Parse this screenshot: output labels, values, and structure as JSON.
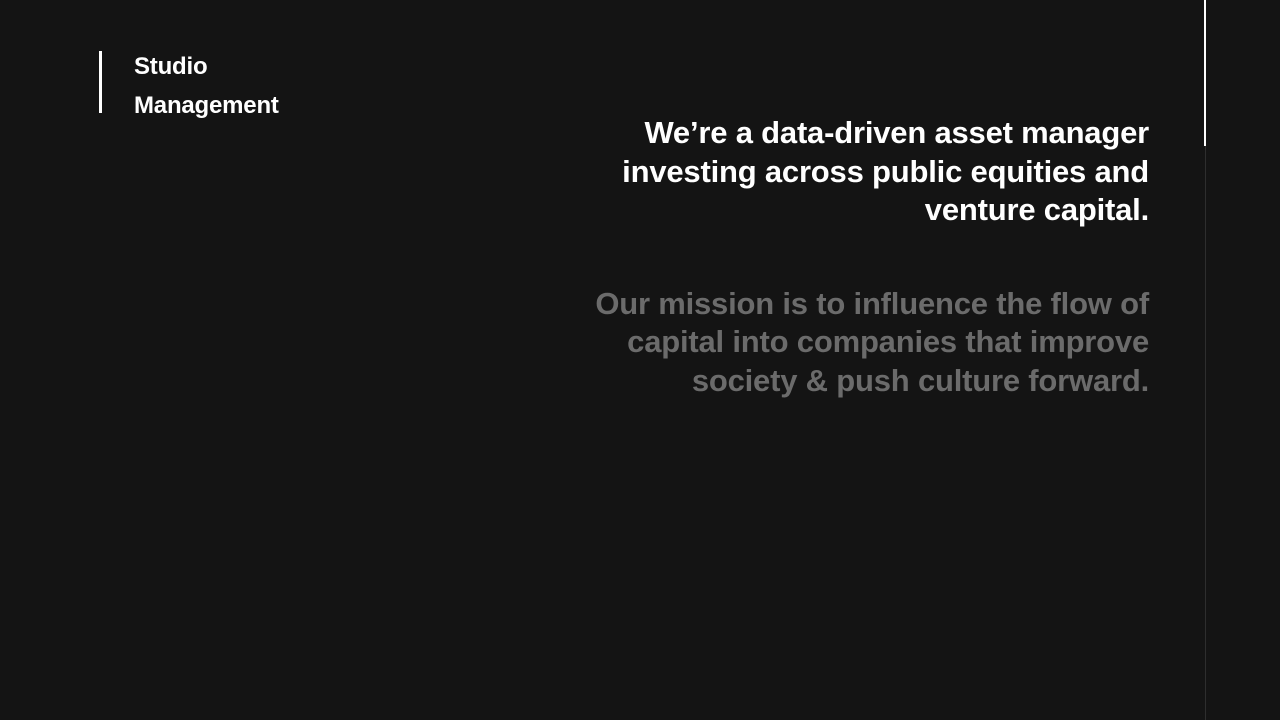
{
  "brand": {
    "line1": "Studio",
    "line2": "Management"
  },
  "headline": {
    "line1": "We’re a data-driven asset manager",
    "line2": "investing across public equities and",
    "line3": "venture capital."
  },
  "mission": {
    "line1": "Our mission is to influence the flow of",
    "line2": "capital into companies that improve",
    "line3": "society & push culture forward."
  },
  "scroll": {
    "progress": 0.2
  },
  "colors": {
    "background": "#141414",
    "primary_text": "#ffffff",
    "muted_text": "#6b6b6b"
  }
}
